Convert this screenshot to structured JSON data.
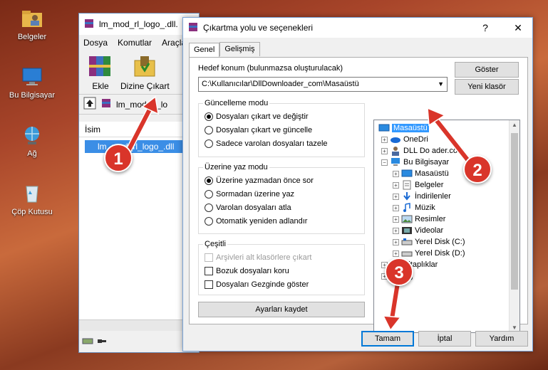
{
  "desktop": {
    "icons": [
      {
        "label": "Belgeler"
      },
      {
        "label": "Bu Bilgisayar"
      },
      {
        "label": "Ağ"
      },
      {
        "label": "Çöp Kutusu"
      }
    ]
  },
  "winrar": {
    "title": "lm_mod_rl_logo_.dll.",
    "menu": [
      "Dosya",
      "Komutlar",
      "Araçla"
    ],
    "toolbar": {
      "add": "Ekle",
      "extract": "Dizine Çıkart"
    },
    "path": "lm_mod_rl_lo",
    "column_name": "İsim",
    "file": "lm_mod_rl_logo_.dll"
  },
  "dialog": {
    "title": "Çıkartma yolu ve seçenekleri",
    "help": "?",
    "close": "✕",
    "tabs": [
      "Genel",
      "Gelişmiş"
    ],
    "dest_label": "Hedef konum (bulunmazsa oluşturulacak)",
    "dest_value": "C:\\Kullanıcılar\\DllDownloader_com\\Masaüstü",
    "show_button": "Göster",
    "new_folder_button": "Yeni klasör",
    "update_group": {
      "title": "Güncelleme modu",
      "options": [
        "Dosyaları çıkart ve değiştir",
        "Dosyaları çıkart ve güncelle",
        "Sadece varolan dosyaları tazele"
      ]
    },
    "overwrite_group": {
      "title": "Üzerine yaz modu",
      "options": [
        "Üzerine yazmadan önce sor",
        "Sormadan üzerine yaz",
        "Varolan dosyaları atla",
        "Otomatik yeniden adlandır"
      ]
    },
    "misc_group": {
      "title": "Çeşitli",
      "options": [
        "Arşivleri alt klasörlere çıkart",
        "Bozuk dosyaları koru",
        "Dosyaları Gezginde göster"
      ]
    },
    "save_button": "Ayarları kaydet",
    "ok_button": "Tamam",
    "cancel_button": "İptal",
    "help_button": "Yardım",
    "tree": [
      {
        "label": "Masaüstü"
      },
      {
        "label": "OneDri"
      },
      {
        "label": "DLL Do"
      },
      {
        "label": "Bu Bilgisayar"
      },
      {
        "label": "Masaüstü"
      },
      {
        "label": "Belgeler"
      },
      {
        "label": "İndirilenler"
      },
      {
        "label": "Müzik"
      },
      {
        "label": "Resimler"
      },
      {
        "label": "Videolar"
      },
      {
        "label": "Yerel Disk (C:)"
      },
      {
        "label": "Yerel Disk (D:)"
      },
      {
        "label": "Kitaplıklar"
      },
      {
        "label": "Ağ"
      }
    ],
    "tree_partial": "ader.com"
  },
  "annotations": {
    "step1": "1",
    "step2": "2",
    "step3": "3"
  }
}
